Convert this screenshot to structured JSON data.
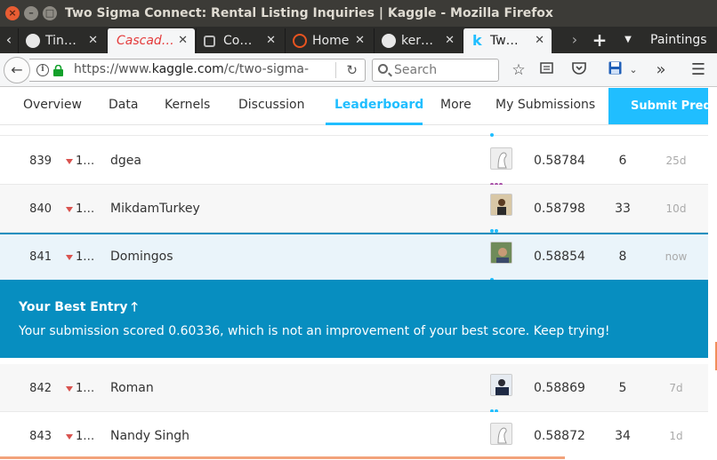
{
  "window": {
    "title": "Two Sigma Connect: Rental Listing Inquiries | Kaggle - Mozilla Firefox"
  },
  "tabs": [
    {
      "label": "Tin…",
      "icon": "github-icon"
    },
    {
      "label": "Cascad…",
      "icon": "none"
    },
    {
      "label": "Co…",
      "icon": "gear-icon"
    },
    {
      "label": "Home",
      "icon": "ubuntu-icon"
    },
    {
      "label": "ker…",
      "icon": "github-icon"
    },
    {
      "label": "Tw…",
      "icon": "kaggle-icon",
      "selected": true
    }
  ],
  "tabbar": {
    "bookmarks_label": "Paintings"
  },
  "navbar": {
    "url_prefix": "https://www.",
    "url_host": "kaggle.com",
    "url_rest": "/c/two-sigma-",
    "search_placeholder": "Search"
  },
  "kaggle_nav": {
    "items": [
      "Overview",
      "Data",
      "Kernels",
      "Discussion",
      "Leaderboard",
      "More",
      "My Submissions"
    ],
    "active": "Leaderboard",
    "submit_label": "Submit Predictions"
  },
  "leaderboard": {
    "rows_before": [
      {
        "rank": "839",
        "delta": "1…",
        "team": "dgea",
        "score": "0.58784",
        "entries": "6",
        "last": "25d",
        "dots": [
          "#a64ca6",
          "#a64ca6",
          "#a64ca6"
        ]
      },
      {
        "rank": "840",
        "delta": "1…",
        "team": "MikdamTurkey",
        "score": "0.58798",
        "entries": "33",
        "last": "10d",
        "dots": [
          "#20beff",
          "#20beff"
        ]
      },
      {
        "rank": "841",
        "delta": "1…",
        "team": "Domingos",
        "score": "0.58854",
        "entries": "8",
        "last": "now",
        "dots": [
          "#20beff"
        ]
      }
    ],
    "best_entry": {
      "title": "Your Best Entry",
      "message": "Your submission scored 0.60336, which is not an improvement of your best score. Keep trying!"
    },
    "rows_after": [
      {
        "rank": "842",
        "delta": "1…",
        "team": "Roman",
        "score": "0.58869",
        "entries": "5",
        "last": "7d",
        "dots": [
          "#20beff",
          "#20beff"
        ]
      },
      {
        "rank": "843",
        "delta": "1…",
        "team": "Nandy Singh",
        "score": "0.58872",
        "entries": "34",
        "last": "1d",
        "dots": []
      }
    ]
  },
  "colors": {
    "accent": "#20beff",
    "banner": "#078ec0",
    "decline": "#d9534f"
  }
}
